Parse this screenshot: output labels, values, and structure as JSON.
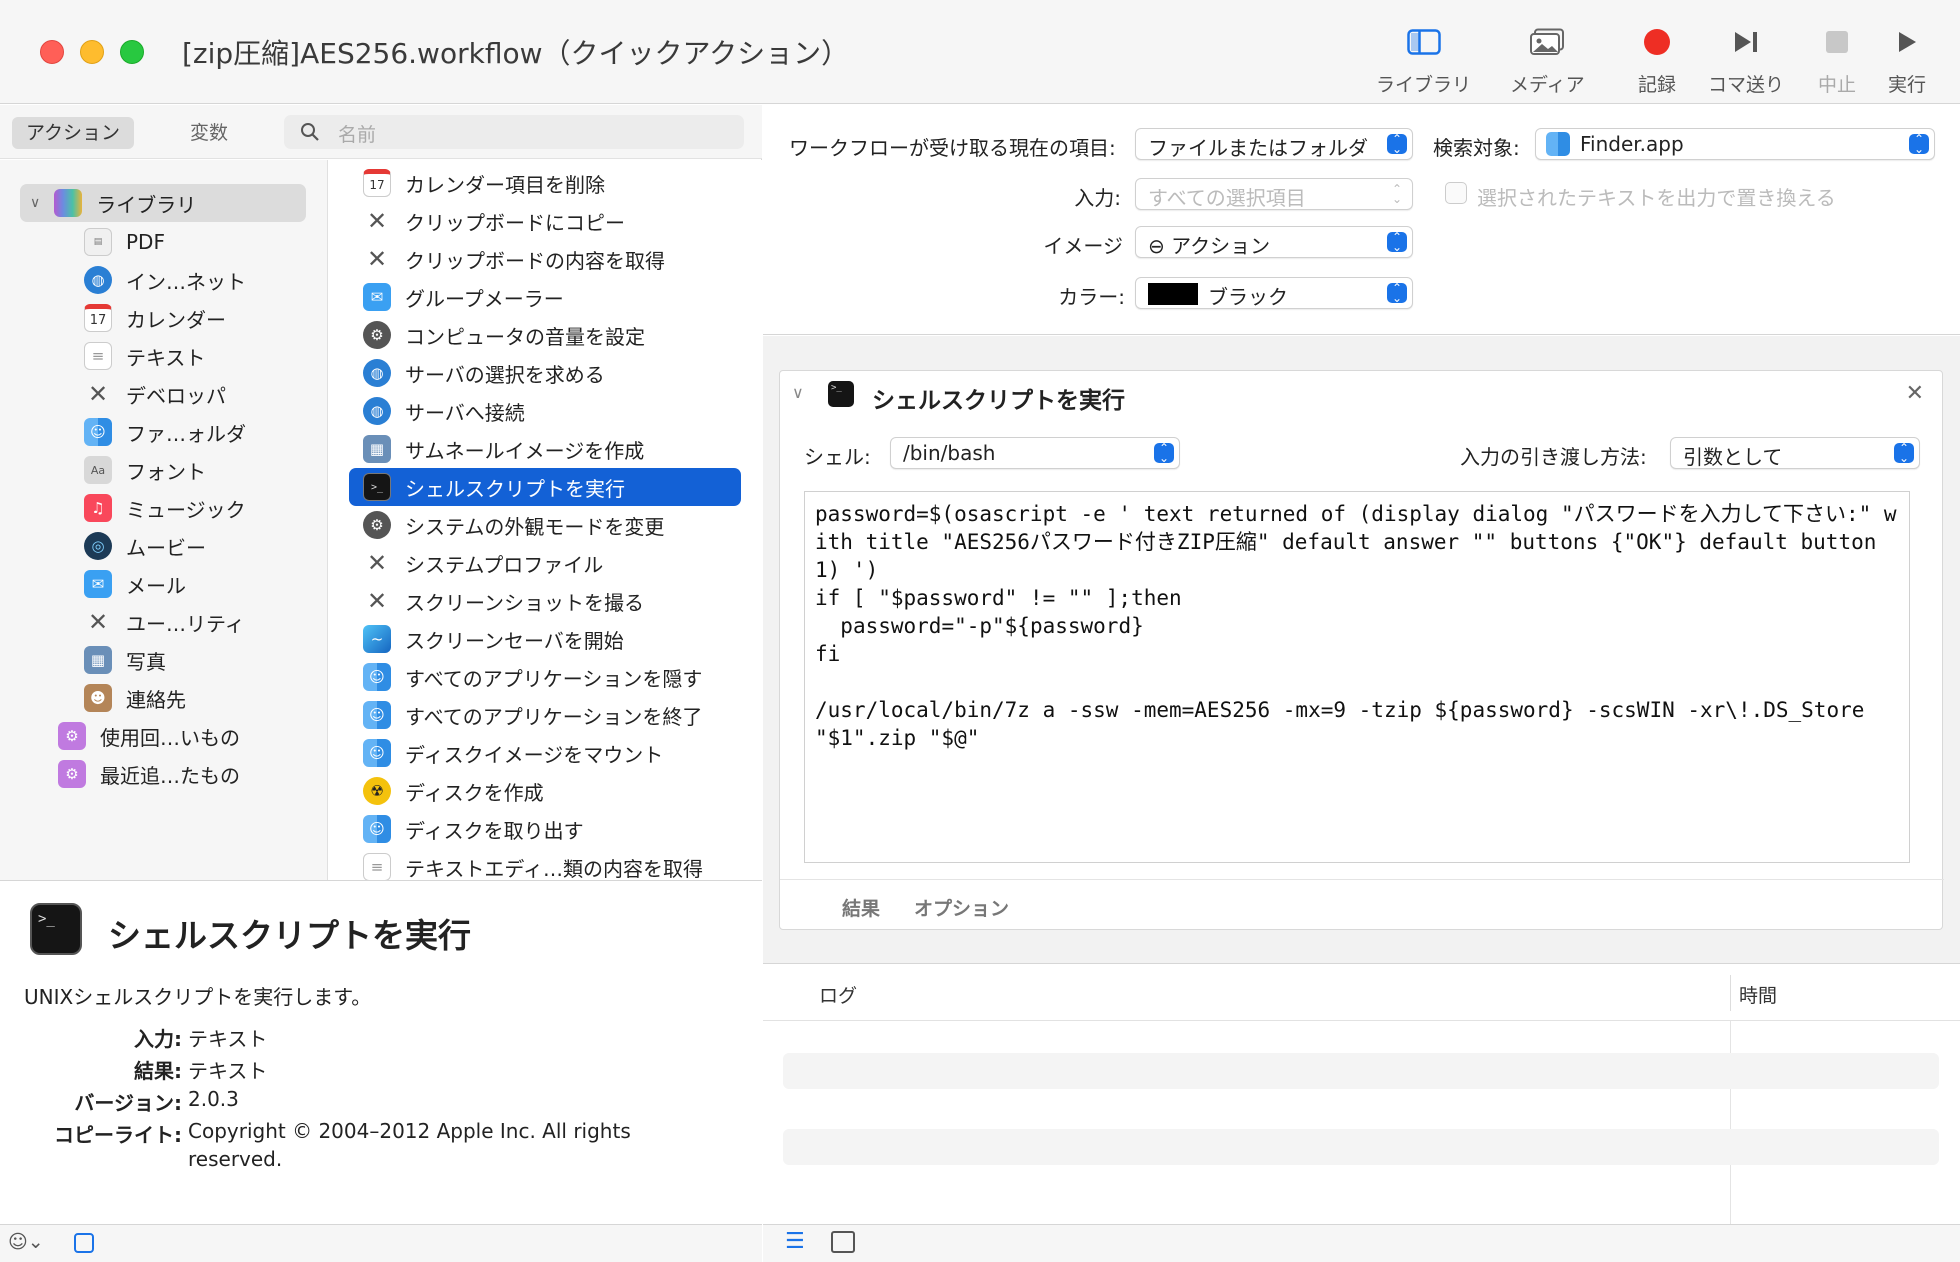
{
  "window": {
    "title": "[zip圧縮]AES256.workflow（クイックアクション）"
  },
  "toolbar": {
    "library": "ライブラリ",
    "media": "メディア",
    "record": "記録",
    "step": "コマ送り",
    "stop": "中止",
    "run": "実行"
  },
  "left_tabs": {
    "actions": "アクション",
    "variables": "変数",
    "search_placeholder": "名前"
  },
  "library": {
    "root": "ライブラリ",
    "items": [
      "PDF",
      "イン…ネット",
      "カレンダー",
      "テキスト",
      "デベロッパ",
      "ファ…ォルダ",
      "フォント",
      "ミュージック",
      "ムービー",
      "メール",
      "ユー…リティ",
      "写真",
      "連絡先"
    ],
    "smart": [
      "使用回…いもの",
      "最近追…たもの"
    ]
  },
  "actions": {
    "items": [
      "カレンダー項目を削除",
      "クリップボードにコピー",
      "クリップボードの内容を取得",
      "グループメーラー",
      "コンピュータの音量を設定",
      "サーバの選択を求める",
      "サーバへ接続",
      "サムネールイメージを作成",
      "シェルスクリプトを実行",
      "システムの外観モードを変更",
      "システムプロファイル",
      "スクリーンショットを撮る",
      "スクリーンセーバを開始",
      "すべてのアプリケーションを隠す",
      "すべてのアプリケーションを終了",
      "ディスクイメージをマウント",
      "ディスクを作成",
      "ディスクを取り出す",
      "テキストエディ…類の内容を取得"
    ],
    "selected_index": 8
  },
  "description": {
    "title": "シェルスクリプトを実行",
    "summary": "UNIXシェルスクリプトを実行します。",
    "input_key": "入力:",
    "input_val": "テキスト",
    "result_key": "結果:",
    "result_val": "テキスト",
    "version_key": "バージョン:",
    "version_val": "2.0.3",
    "copyright_key": "コピーライト:",
    "copyright_val": "Copyright © 2004–2012 Apple Inc.  All rights",
    "copyright_val2": "reserved."
  },
  "workflow": {
    "receives_label": "ワークフローが受け取る現在の項目:",
    "receives_value": "ファイルまたはフォルダ",
    "search_label": "検索対象:",
    "search_value": "Finder.app",
    "input_label": "入力:",
    "input_value": "すべての選択項目",
    "replace_label": "選択されたテキストを出力で置き換える",
    "image_label": "イメージ",
    "image_value": "⊖ アクション",
    "color_label": "カラー:",
    "color_value": "ブラック"
  },
  "action_box": {
    "title": "シェルスクリプトを実行",
    "shell_label": "シェル:",
    "shell_value": "/bin/bash",
    "pass_label": "入力の引き渡し方法:",
    "pass_value": "引数として",
    "script": "password=$(osascript -e ' text returned of (display dialog \"パスワードを入力して下さい:\" with title \"AES256パスワード付きZIP圧縮\" default answer \"\" buttons {\"OK\"} default button 1) ')\nif [ \"$password\" != \"\" ];then\n  password=\"-p\"${password}\nfi\n\n/usr/local/bin/7z a -ssw -mem=AES256 -mx=9 -tzip ${password} -scsWIN -xr\\!.DS_Store \"$1\".zip \"$@\"",
    "tab_results": "結果",
    "tab_options": "オプション"
  },
  "log": {
    "col_log": "ログ",
    "col_time": "時間"
  }
}
